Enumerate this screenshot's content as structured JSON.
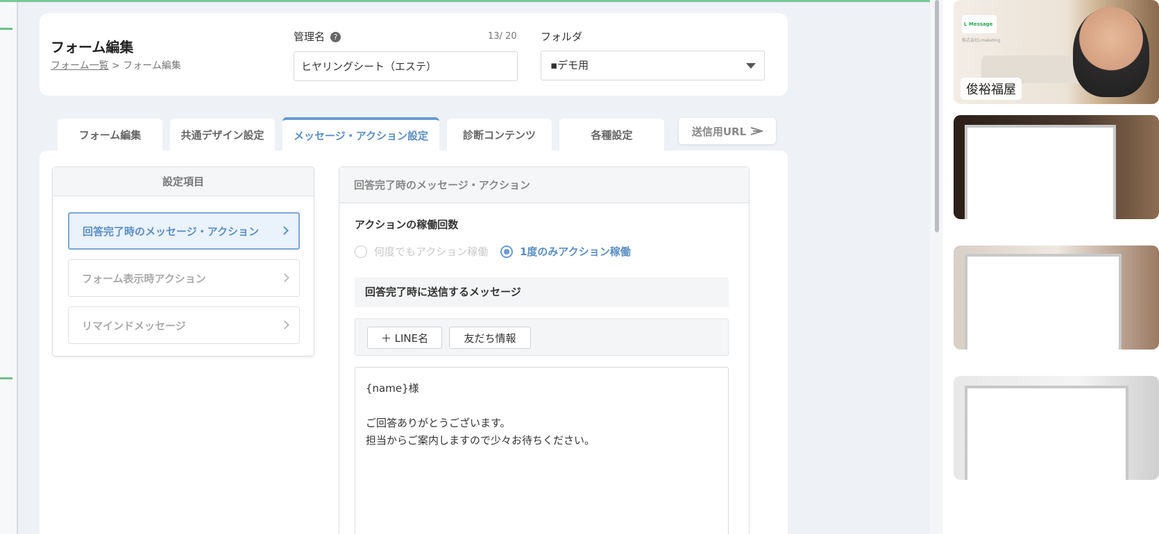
{
  "header": {
    "title": "フォーム編集",
    "breadcrumb_link": "フォーム一覧",
    "breadcrumb_sep": ">",
    "breadcrumb_current": "フォーム編集",
    "mgmt_label": "管理名",
    "help_glyph": "?",
    "char_count": "13/ 20",
    "mgmt_value": "ヒヤリングシート（エステ）",
    "folder_label": "フォルダ",
    "folder_value": "▪デモ用"
  },
  "tabs": [
    {
      "label": "フォーム編集"
    },
    {
      "label": "共通デザイン設定"
    },
    {
      "label": "メッセージ・アクション設定"
    },
    {
      "label": "診断コンテンツ"
    },
    {
      "label": "各種設定"
    }
  ],
  "send_url": {
    "label": "送信用URL"
  },
  "sidebar": {
    "title": "設定項目",
    "items": [
      {
        "label": "回答完了時のメッセージ・アクション"
      },
      {
        "label": "フォーム表示時アクション"
      },
      {
        "label": "リマインドメッセージ"
      }
    ]
  },
  "panel": {
    "title": "回答完了時のメッセージ・アクション",
    "section_title": "アクションの稼働回数",
    "radio_options": [
      {
        "label": "何度でもアクション稼働",
        "selected": false
      },
      {
        "label": "1度のみアクション稼働",
        "selected": true
      }
    ],
    "subhead": "回答完了時に送信するメッセージ",
    "toolbar": {
      "line_name_button": "＋ LINE名",
      "friend_info_button": "友だち情報"
    },
    "message_lines": [
      "{name}様",
      "",
      "ご回答ありがとうございます。",
      "担当からご案内しますので少々お待ちください。"
    ]
  },
  "video": {
    "participant_name": "俊裕福屋",
    "logo_text": "L Message",
    "logo_sub": "株式会社Lmaketing"
  },
  "colors": {
    "accent": "#6b9bd1",
    "accent_text": "#5b8fc4",
    "top_line": "#7bc79a"
  }
}
